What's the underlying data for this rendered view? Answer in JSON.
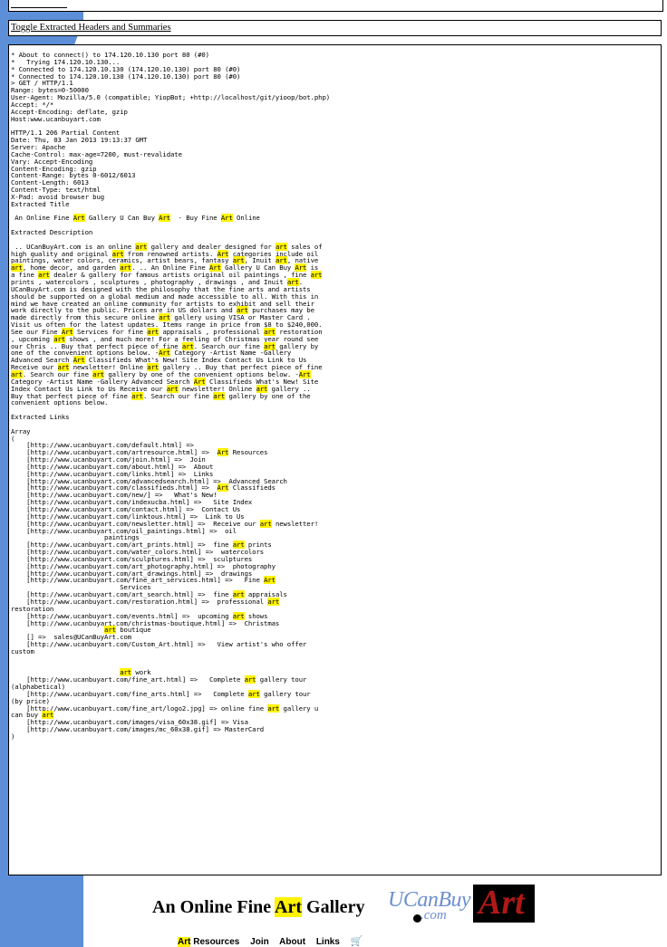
{
  "toggle_label": "Toggle Extracted Headers and Summaries",
  "log_lines": [
    "* About to connect() to 174.120.10.130 port 80 (#0)",
    "*   Trying 174.120.10.130...",
    "* Connected to 174.120.10.130 (174.120.10.130) port 80 (#0)",
    "* Connected to 174.120.10.130 (174.120.10.130) port 80 (#0)",
    "> GET / HTTP/1.1",
    "Range: bytes=0-50000",
    "User-Agent: Mozilla/5.0 (compatible; YiopBot; +http://localhost/git/yioop/bot.php)",
    "Accept: */*",
    "Accept-Encoding: deflate, gzip",
    "Host:www.ucanbuyart.com",
    "",
    "HTTP/1.1 206 Partial Content",
    "Date: Thu, 03 Jan 2013 19:13:37 GMT",
    "Server: Apache",
    "Cache-Control: max-age=7200, must-revalidate",
    "Vary: Accept-Encoding",
    "Content-Encoding: gzip",
    "Content-Range: bytes 0-6012/6013",
    "Content-Length: 6013",
    "Content-Type: text/html",
    "X-Pad: avoid browser bug",
    "Extracted Title",
    "",
    " An Online Fine Art Gallery U Can Buy Art  - Buy Fine Art Online",
    "",
    "Extracted Description",
    "",
    " .. UCanBuyArt.com is an online art gallery and dealer designed for art sales of",
    "high quality and original art from renowned artists. Art categories include oil",
    "paintings, water colors, ceramics, artist bears, fantasy art, Inuit art, native",
    "art, home decor, and garden art. .. An Online Fine Art Gallery U Can Buy Art is",
    "a fine art dealer & gallery for famous artists original oil paintings , fine art",
    "prints , watercolors , sculptures , photography , drawings , and Inuit art.",
    "UCanBuyArt.com is designed with the philosophy that the fine arts and artists",
    "should be supported on a global medium and made accessible to all. With this in",
    "mind we have created an online community for artists to exhibit and sell their",
    "work directly to the public. Prices are in US dollars and art purchases may be",
    "made directly from this secure online art gallery using VISA or Master Card .",
    "Visit us often for the latest updates. Items range in price from $8 to $240,000.",
    "See our Fine Art Services for fine art appraisals , professional art restoration",
    ", upcoming art shows , and much more! For a feeling of Christmas year round see",
    "our Chris .. Buy that perfect piece of fine art. Search our fine art gallery by",
    "one of the convenient options below. -Art Category -Artist Name -Gallery",
    "Advanced Search Art Classifieds What's New! Site Index Contact Us Link to Us",
    "Receive our art newsletter! Online art gallery .. Buy that perfect piece of fine",
    "art. Search our fine art gallery by one of the convenient options below. -Art",
    "Category -Artist Name -Gallery Advanced Search Art Classifieds What's New! Site",
    "Index Contact Us Link to Us Receive our art newsletter! Online art gallery ..",
    "Buy that perfect piece of fine art. Search our fine art gallery by one of the",
    "convenient options below.",
    "",
    "Extracted Links",
    "",
    "Array",
    "(",
    "    [http://www.ucanbuyart.com/default.html] =>",
    "    [http://www.ucanbuyart.com/artresource.html] =>  Art Resources",
    "    [http://www.ucanbuyart.com/join.html] =>  Join",
    "    [http://www.ucanbuyart.com/about.html] =>  About",
    "    [http://www.ucanbuyart.com/links.html] =>  Links",
    "    [http://www.ucanbuyart.com/advancedsearch.html] =>  Advanced Search",
    "    [http://www.ucanbuyart.com/classifieds.html] =>  Art Classifieds",
    "    [http://www.ucanbuyart.com/new/] =>   What's New!",
    "    [http://www.ucanbuyart.com/indexucba.html] =>   Site Index",
    "    [http://www.ucanbuyart.com/contact.html] =>  Contact Us",
    "    [http://www.ucanbuyart.com/linktous.html] =>  Link to Us",
    "    [http://www.ucanbuyart.com/newsletter.html] =>  Receive our art newsletter!",
    "    [http://www.ucanbuyart.com/oil_paintings.html] =>  oil",
    "                        paintings",
    "    [http://www.ucanbuyart.com/art_prints.html] =>  fine art prints",
    "    [http://www.ucanbuyart.com/water_colors.html] =>  watercolors",
    "    [http://www.ucanbuyart.com/sculptures.html] =>  sculptures",
    "    [http://www.ucanbuyart.com/art_photography.html] =>  photography",
    "    [http://www.ucanbuyart.com/art_drawings.html] =>  drawings",
    "    [http://www.ucanbuyart.com/fine_art_services.html] =>   Fine Art",
    "                            Services",
    "    [http://www.ucanbuyart.com/art_search.html] =>  fine art appraisals",
    "    [http://www.ucanbuyart.com/restoration.html] =>  professional art",
    "restoration",
    "    [http://www.ucanbuyart.com/events.html] =>  upcoming art shows",
    "    [http://www.ucanbuyart.com/christmas-boutique.html] =>  Christmas",
    "                        art boutique",
    "    [] =>  sales@UCanBuyArt.com",
    "    [http://www.ucanbuyart.com/Custom_Art.html] =>   View artist's who offer",
    "custom",
    "",
    "",
    "                            art work",
    "    [http://www.ucanbuyart.com/fine_art.html] =>   Complete art gallery tour",
    "(alphabetical)",
    "    [http://www.ucanbuyart.com/fine_arts.html] =>   Complete art gallery tour",
    "(by price)",
    "    [http://www.ucanbuyart.com/fine_art/logo2.jpg] => online fine art gallery u",
    "can buy art",
    "    [http://www.ucanbuyart.com/images/visa_60x38.gif] => Visa",
    "    [http://www.ucanbuyart.com/images/mc_60x38.gif] => MasterCard",
    ")"
  ],
  "footer": {
    "title_before": "An Online Fine ",
    "title_highlight": "Art",
    "title_after": " Gallery",
    "logo_ucan": "UCanBuy",
    "logo_com": ".com",
    "logo_art": "Art",
    "nav": [
      {
        "highlight": "Art",
        "rest": " Resources"
      },
      {
        "highlight": "",
        "rest": "Join"
      },
      {
        "highlight": "",
        "rest": "About"
      },
      {
        "highlight": "",
        "rest": "Links"
      }
    ]
  },
  "colors": {
    "highlight": "#fff200",
    "sidebar_blue": "#5d8fd8",
    "logo_red": "#b01818",
    "logo_blue": "#6c8fcf"
  },
  "icons": {
    "cart": "shopping-cart-icon"
  }
}
